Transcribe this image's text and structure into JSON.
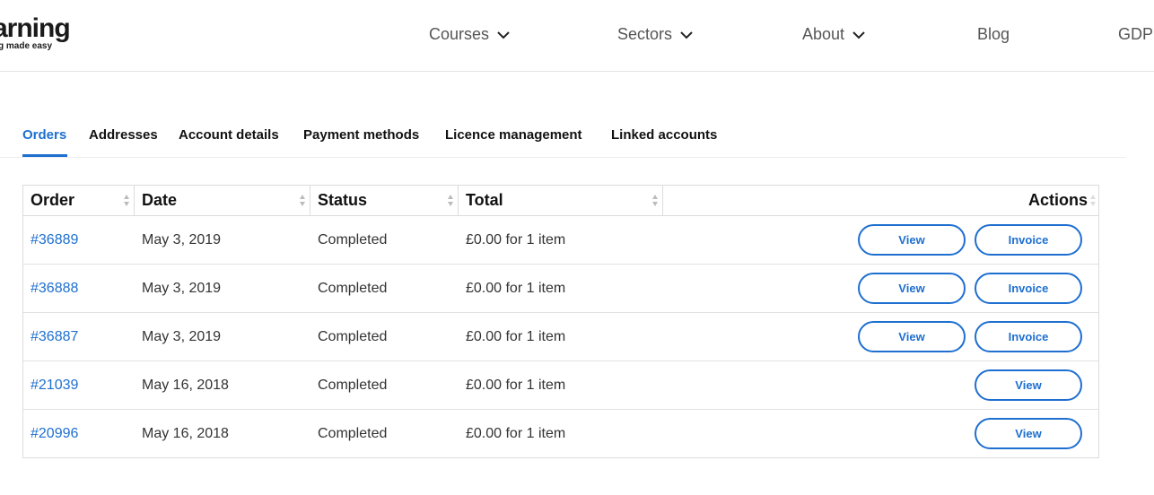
{
  "brand": {
    "logo_text": "arning",
    "tagline": "g made easy"
  },
  "nav": [
    {
      "label": "Courses",
      "has_dropdown": true
    },
    {
      "label": "Sectors",
      "has_dropdown": true
    },
    {
      "label": "About",
      "has_dropdown": true
    },
    {
      "label": "Blog",
      "has_dropdown": false
    },
    {
      "label": "GDP",
      "has_dropdown": false
    }
  ],
  "tabs": [
    {
      "label": "Orders",
      "active": true
    },
    {
      "label": "Addresses"
    },
    {
      "label": "Account details"
    },
    {
      "label": "Payment methods"
    },
    {
      "label": "Licence management"
    },
    {
      "label": "Linked accounts"
    }
  ],
  "table": {
    "headers": {
      "order": "Order",
      "date": "Date",
      "status": "Status",
      "total": "Total",
      "actions": "Actions"
    },
    "rows": [
      {
        "order": "#36889",
        "date": "May 3, 2019",
        "status": "Completed",
        "total": "£0.00 for 1 item",
        "view": "View",
        "invoice": "Invoice"
      },
      {
        "order": "#36888",
        "date": "May 3, 2019",
        "status": "Completed",
        "total": "£0.00 for 1 item",
        "view": "View",
        "invoice": "Invoice"
      },
      {
        "order": "#36887",
        "date": "May 3, 2019",
        "status": "Completed",
        "total": "£0.00 for 1 item",
        "view": "View",
        "invoice": "Invoice"
      },
      {
        "order": "#21039",
        "date": "May 16, 2018",
        "status": "Completed",
        "total": "£0.00 for 1 item",
        "view": "View"
      },
      {
        "order": "#20996",
        "date": "May 16, 2018",
        "status": "Completed",
        "total": "£0.00 for 1 item",
        "view": "View"
      }
    ]
  },
  "colors": {
    "accent": "#1e6fd0",
    "text": "#333333",
    "border": "#dcdcdc"
  }
}
